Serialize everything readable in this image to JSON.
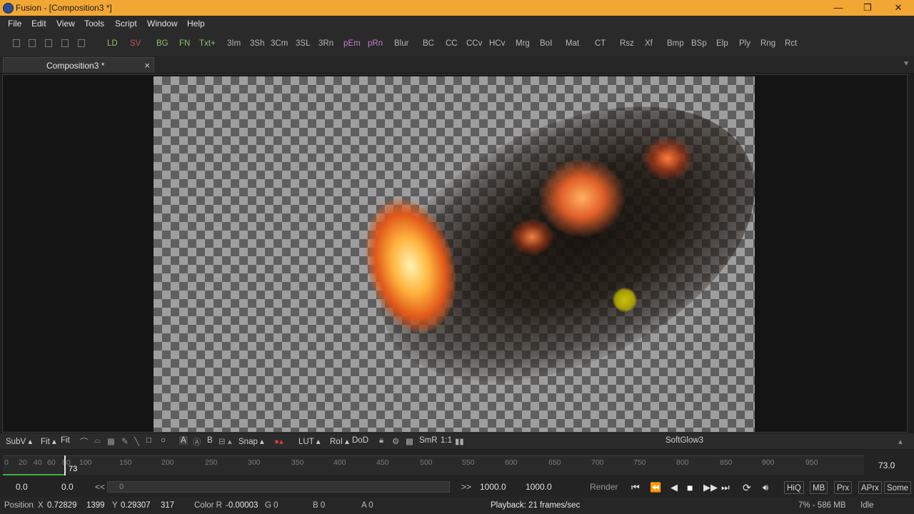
{
  "window": {
    "title": "Fusion - [Composition3 *]",
    "minimize_icon": "—",
    "maximize_icon": "❐",
    "close_icon": "✕"
  },
  "menu": [
    "File",
    "Edit",
    "View",
    "Tools",
    "Script",
    "Window",
    "Help"
  ],
  "toolbar": [
    {
      "label": "LD",
      "color": "#8fc26a"
    },
    {
      "label": "SV",
      "color": "#c25656"
    },
    {
      "label": "BG",
      "color": "#8fc26a"
    },
    {
      "label": "FN",
      "color": "#8fc26a"
    },
    {
      "label": "Txt+",
      "color": "#8fc26a"
    },
    {
      "label": "3Im",
      "color": "#b8b8b8"
    },
    {
      "label": "3Sh",
      "color": "#b8b8b8"
    },
    {
      "label": "3Cm",
      "color": "#b8b8b8"
    },
    {
      "label": "3SL",
      "color": "#b8b8b8"
    },
    {
      "label": "3Rn",
      "color": "#b8b8b8"
    },
    {
      "label": "pEm",
      "color": "#c77dd0"
    },
    {
      "label": "pRn",
      "color": "#c77dd0"
    },
    {
      "label": "Blur",
      "color": "#b8b8b8"
    },
    {
      "label": "BC",
      "color": "#b8b8b8"
    },
    {
      "label": "CC",
      "color": "#b8b8b8"
    },
    {
      "label": "CCv",
      "color": "#b8b8b8"
    },
    {
      "label": "HCv",
      "color": "#b8b8b8"
    },
    {
      "label": "Mrg",
      "color": "#b8b8b8"
    },
    {
      "label": "BoI",
      "color": "#b8b8b8"
    },
    {
      "label": "Mat",
      "color": "#b8b8b8"
    },
    {
      "label": "CT",
      "color": "#b8b8b8"
    },
    {
      "label": "Rsz",
      "color": "#b8b8b8"
    },
    {
      "label": "Xf",
      "color": "#b8b8b8"
    },
    {
      "label": "Bmp",
      "color": "#b8b8b8"
    },
    {
      "label": "BSp",
      "color": "#b8b8b8"
    },
    {
      "label": "Elp",
      "color": "#b8b8b8"
    },
    {
      "label": "Ply",
      "color": "#b8b8b8"
    },
    {
      "label": "Rng",
      "color": "#b8b8b8"
    },
    {
      "label": "Rct",
      "color": "#b8b8b8"
    }
  ],
  "tab": {
    "label": "Composition3 *",
    "close": "×"
  },
  "viewer_controls": {
    "subv": "SubV ▴",
    "fit1": "Fit ▴",
    "fit2": "Fit",
    "a": "A",
    "b": "B",
    "snap": "Snap ▴",
    "lut": "LUT ▴",
    "roi": "RoI ▴",
    "dod": "DoD",
    "smr": "SmR",
    "ratio": "1:1",
    "node_name": "SoftGlow3"
  },
  "timeline": {
    "ticks": [
      "0",
      "20",
      "40",
      "60",
      "80",
      "100",
      "150",
      "200",
      "250",
      "300",
      "350",
      "400",
      "450",
      "500",
      "550",
      "600",
      "650",
      "700",
      "750",
      "800",
      "850",
      "900",
      "950"
    ],
    "current_frame": "73",
    "end_value": "73.0"
  },
  "transport": {
    "start": "0.0",
    "render_start": "0.0",
    "rewind": "<<",
    "scrub_value": "0",
    "ff": ">>",
    "end1": "1000.0",
    "end2": "1000.0",
    "render": "Render",
    "buttons": [
      "HiQ",
      "MB",
      "Prx",
      "APrx",
      "Some"
    ]
  },
  "status": {
    "position_label": "Position",
    "x_label": "X",
    "x_val": "0.72829",
    "x_px": "1399",
    "y_label": "Y",
    "y_val": "0.29307",
    "y_px": "317",
    "color_label": "Color R",
    "r_val": "-0.00003",
    "g": "G 0",
    "b": "B 0",
    "a": "A 0",
    "playback": "Playback: 21 frames/sec",
    "memory": "7% - 586 MB",
    "state": "Idle"
  }
}
